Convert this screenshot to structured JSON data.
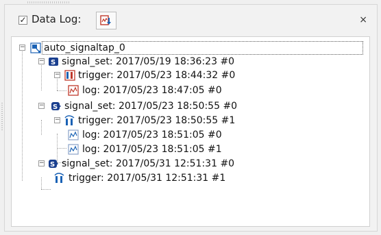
{
  "header": {
    "datalog_label": "Data Log:",
    "checkbox_checked": true,
    "close_glyph": "×"
  },
  "tree": {
    "root": "auto_signaltap_0",
    "nodes": [
      {
        "label": "signal_set: 2017/05/19 18:36:23  #0",
        "type": "signal_set"
      },
      {
        "label": "trigger: 2017/05/23 18:44:32  #0",
        "type": "trigger"
      },
      {
        "label": "log: 2017/05/23 18:47:05  #0",
        "type": "log"
      },
      {
        "label": "signal_set: 2017/05/23 18:50:55  #0",
        "type": "signal_set"
      },
      {
        "label": "trigger: 2017/05/23 18:50:55  #1",
        "type": "trigger"
      },
      {
        "label": "log: 2017/05/23 18:51:05  #0",
        "type": "log"
      },
      {
        "label": "log: 2017/05/23 18:51:05  #1",
        "type": "log"
      },
      {
        "label": "signal_set: 2017/05/31 12:51:31  #0",
        "type": "signal_set"
      },
      {
        "label": "trigger: 2017/05/31 12:51:31  #1",
        "type": "trigger"
      }
    ]
  }
}
